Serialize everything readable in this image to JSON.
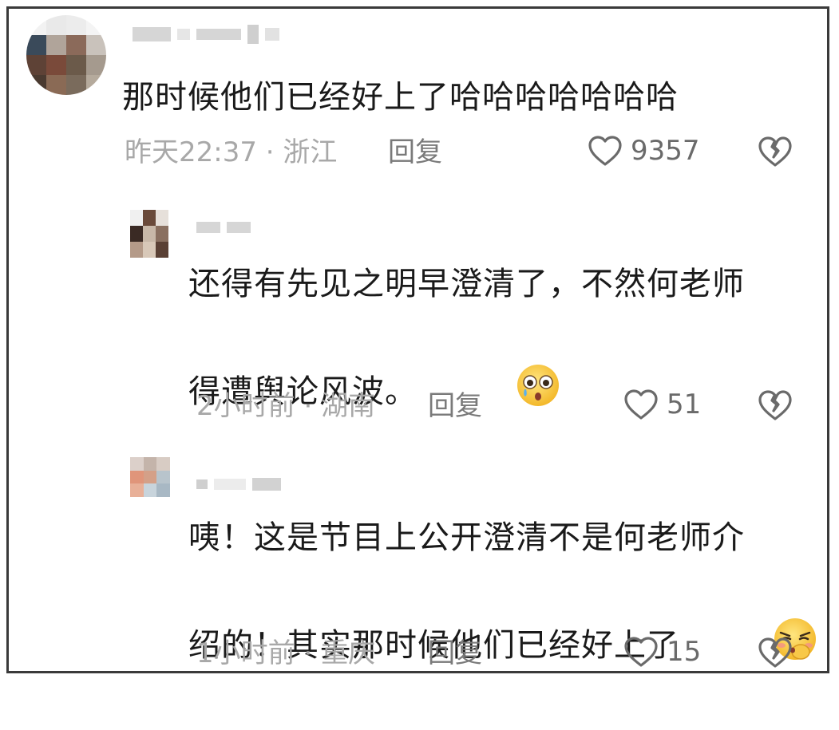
{
  "comments": [
    {
      "text": "那时候他们已经好上了哈哈哈哈哈哈哈",
      "time": "昨天22:37",
      "location": "浙江",
      "reply_label": "回复",
      "likes": "9357",
      "emoji": null
    },
    {
      "text": "还得有先见之明早澄清了，不然何老师\n得遭舆论风波。",
      "time": "2小时前",
      "location": "湖南",
      "reply_label": "回复",
      "likes": "51",
      "emoji": "shocked-crying-emoji"
    },
    {
      "text": "咦！这是节目上公开澄清不是何老师介\n绍的！其实那时候他们已经好上了",
      "time": "1小时前",
      "location": "重庆",
      "reply_label": "回复",
      "likes": "15",
      "emoji": "smug-emoji"
    }
  ],
  "meta_separator": " · ",
  "colors": {
    "text": "#1a1a1a",
    "meta": "#a8a8a8",
    "icon": "#6a6a6a",
    "border": "#3a3a3a"
  }
}
